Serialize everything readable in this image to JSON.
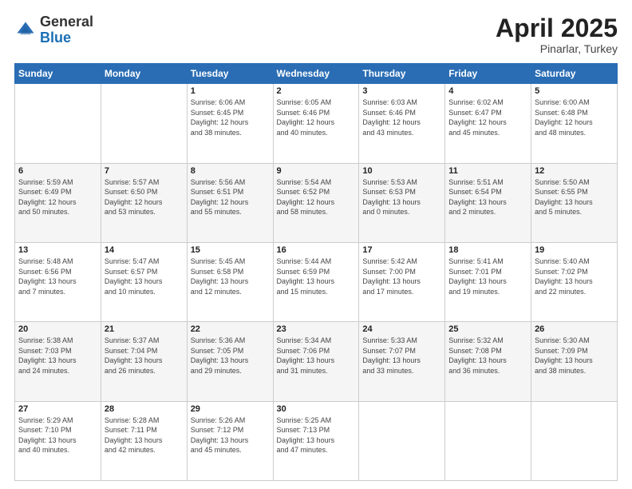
{
  "header": {
    "logo_general": "General",
    "logo_blue": "Blue",
    "month": "April 2025",
    "location": "Pinarlar, Turkey"
  },
  "days_of_week": [
    "Sunday",
    "Monday",
    "Tuesday",
    "Wednesday",
    "Thursday",
    "Friday",
    "Saturday"
  ],
  "weeks": [
    [
      {
        "day": "",
        "info": ""
      },
      {
        "day": "",
        "info": ""
      },
      {
        "day": "1",
        "info": "Sunrise: 6:06 AM\nSunset: 6:45 PM\nDaylight: 12 hours\nand 38 minutes."
      },
      {
        "day": "2",
        "info": "Sunrise: 6:05 AM\nSunset: 6:46 PM\nDaylight: 12 hours\nand 40 minutes."
      },
      {
        "day": "3",
        "info": "Sunrise: 6:03 AM\nSunset: 6:46 PM\nDaylight: 12 hours\nand 43 minutes."
      },
      {
        "day": "4",
        "info": "Sunrise: 6:02 AM\nSunset: 6:47 PM\nDaylight: 12 hours\nand 45 minutes."
      },
      {
        "day": "5",
        "info": "Sunrise: 6:00 AM\nSunset: 6:48 PM\nDaylight: 12 hours\nand 48 minutes."
      }
    ],
    [
      {
        "day": "6",
        "info": "Sunrise: 5:59 AM\nSunset: 6:49 PM\nDaylight: 12 hours\nand 50 minutes."
      },
      {
        "day": "7",
        "info": "Sunrise: 5:57 AM\nSunset: 6:50 PM\nDaylight: 12 hours\nand 53 minutes."
      },
      {
        "day": "8",
        "info": "Sunrise: 5:56 AM\nSunset: 6:51 PM\nDaylight: 12 hours\nand 55 minutes."
      },
      {
        "day": "9",
        "info": "Sunrise: 5:54 AM\nSunset: 6:52 PM\nDaylight: 12 hours\nand 58 minutes."
      },
      {
        "day": "10",
        "info": "Sunrise: 5:53 AM\nSunset: 6:53 PM\nDaylight: 13 hours\nand 0 minutes."
      },
      {
        "day": "11",
        "info": "Sunrise: 5:51 AM\nSunset: 6:54 PM\nDaylight: 13 hours\nand 2 minutes."
      },
      {
        "day": "12",
        "info": "Sunrise: 5:50 AM\nSunset: 6:55 PM\nDaylight: 13 hours\nand 5 minutes."
      }
    ],
    [
      {
        "day": "13",
        "info": "Sunrise: 5:48 AM\nSunset: 6:56 PM\nDaylight: 13 hours\nand 7 minutes."
      },
      {
        "day": "14",
        "info": "Sunrise: 5:47 AM\nSunset: 6:57 PM\nDaylight: 13 hours\nand 10 minutes."
      },
      {
        "day": "15",
        "info": "Sunrise: 5:45 AM\nSunset: 6:58 PM\nDaylight: 13 hours\nand 12 minutes."
      },
      {
        "day": "16",
        "info": "Sunrise: 5:44 AM\nSunset: 6:59 PM\nDaylight: 13 hours\nand 15 minutes."
      },
      {
        "day": "17",
        "info": "Sunrise: 5:42 AM\nSunset: 7:00 PM\nDaylight: 13 hours\nand 17 minutes."
      },
      {
        "day": "18",
        "info": "Sunrise: 5:41 AM\nSunset: 7:01 PM\nDaylight: 13 hours\nand 19 minutes."
      },
      {
        "day": "19",
        "info": "Sunrise: 5:40 AM\nSunset: 7:02 PM\nDaylight: 13 hours\nand 22 minutes."
      }
    ],
    [
      {
        "day": "20",
        "info": "Sunrise: 5:38 AM\nSunset: 7:03 PM\nDaylight: 13 hours\nand 24 minutes."
      },
      {
        "day": "21",
        "info": "Sunrise: 5:37 AM\nSunset: 7:04 PM\nDaylight: 13 hours\nand 26 minutes."
      },
      {
        "day": "22",
        "info": "Sunrise: 5:36 AM\nSunset: 7:05 PM\nDaylight: 13 hours\nand 29 minutes."
      },
      {
        "day": "23",
        "info": "Sunrise: 5:34 AM\nSunset: 7:06 PM\nDaylight: 13 hours\nand 31 minutes."
      },
      {
        "day": "24",
        "info": "Sunrise: 5:33 AM\nSunset: 7:07 PM\nDaylight: 13 hours\nand 33 minutes."
      },
      {
        "day": "25",
        "info": "Sunrise: 5:32 AM\nSunset: 7:08 PM\nDaylight: 13 hours\nand 36 minutes."
      },
      {
        "day": "26",
        "info": "Sunrise: 5:30 AM\nSunset: 7:09 PM\nDaylight: 13 hours\nand 38 minutes."
      }
    ],
    [
      {
        "day": "27",
        "info": "Sunrise: 5:29 AM\nSunset: 7:10 PM\nDaylight: 13 hours\nand 40 minutes."
      },
      {
        "day": "28",
        "info": "Sunrise: 5:28 AM\nSunset: 7:11 PM\nDaylight: 13 hours\nand 42 minutes."
      },
      {
        "day": "29",
        "info": "Sunrise: 5:26 AM\nSunset: 7:12 PM\nDaylight: 13 hours\nand 45 minutes."
      },
      {
        "day": "30",
        "info": "Sunrise: 5:25 AM\nSunset: 7:13 PM\nDaylight: 13 hours\nand 47 minutes."
      },
      {
        "day": "",
        "info": ""
      },
      {
        "day": "",
        "info": ""
      },
      {
        "day": "",
        "info": ""
      }
    ]
  ]
}
